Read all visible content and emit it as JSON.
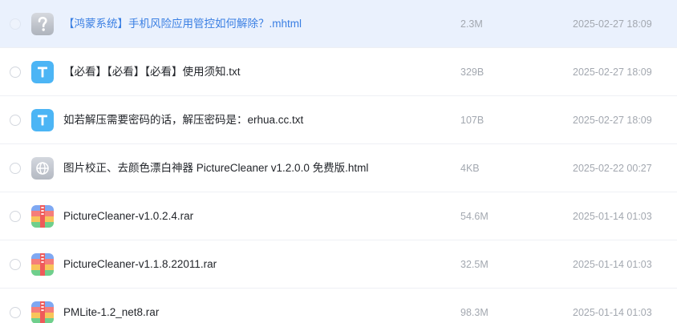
{
  "files": [
    {
      "name": "【鸿蒙系统】手机风险应用管控如何解除？.mhtml",
      "size": "2.3M",
      "date": "2025-02-27 18:09",
      "icon": "unknown-file-icon"
    },
    {
      "name": "【必看】【必看】【必看】使用须知.txt",
      "size": "329B",
      "date": "2025-02-27 18:09",
      "icon": "text-file-icon"
    },
    {
      "name": "如若解压需要密码的话，解压密码是：erhua.cc.txt",
      "size": "107B",
      "date": "2025-02-27 18:09",
      "icon": "text-file-icon"
    },
    {
      "name": "图片校正、去颜色漂白神器 PictureCleaner v1.2.0.0 免费版.html",
      "size": "4KB",
      "date": "2025-02-22 00:27",
      "icon": "web-file-icon"
    },
    {
      "name": "PictureCleaner-v1.0.2.4.rar",
      "size": "54.6M",
      "date": "2025-01-14 01:03",
      "icon": "archive-file-icon"
    },
    {
      "name": "PictureCleaner-v1.1.8.22011.rar",
      "size": "32.5M",
      "date": "2025-01-14 01:03",
      "icon": "archive-file-icon"
    },
    {
      "name": "PMLite-1.2_net8.rar",
      "size": "98.3M",
      "date": "2025-01-14 01:03",
      "icon": "archive-file-icon"
    }
  ],
  "colors": {
    "hover_row": "#eaf1fd",
    "link_blue": "#3a7fe3",
    "muted_text": "#a3a8b0",
    "text_icon": "#4cb5f5"
  }
}
